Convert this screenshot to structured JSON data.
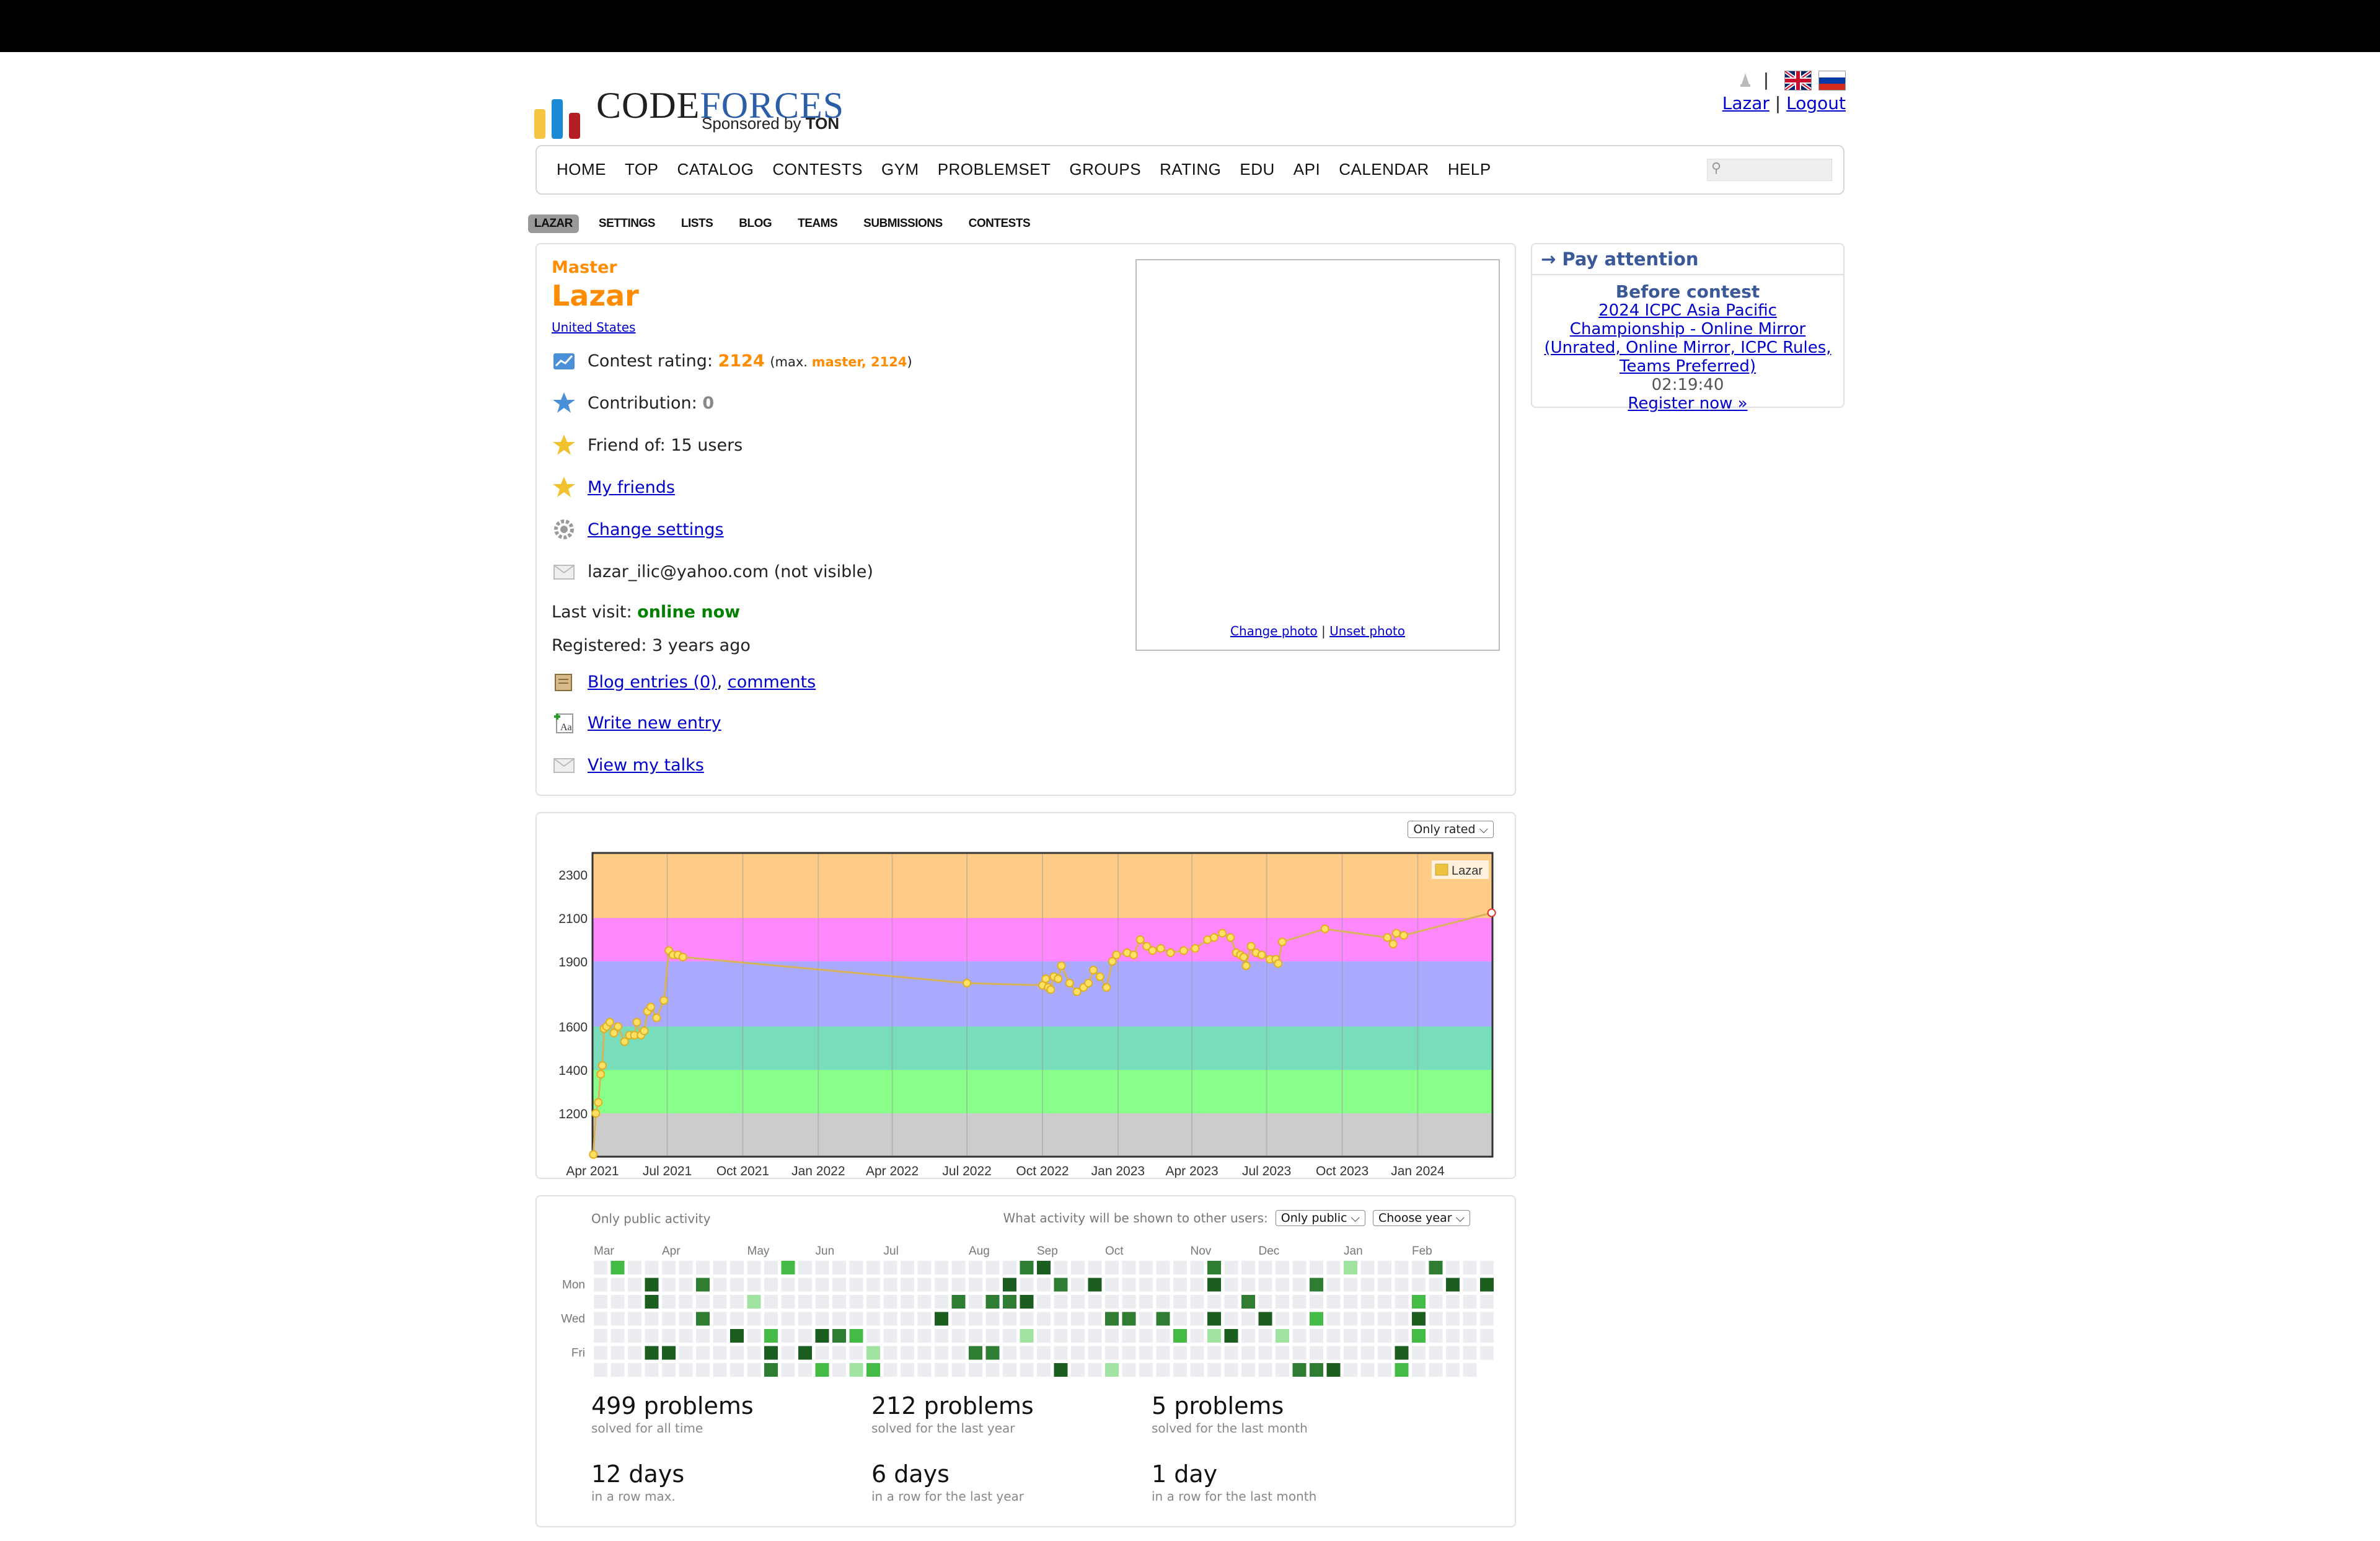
{
  "header": {
    "logo_brand_first": "CODE",
    "logo_brand_second": "FORCES",
    "logo_sponsor_prefix": "Sponsored by",
    "logo_sponsor_name": "TON",
    "lang_separator": "|",
    "user_link": "Lazar",
    "user_separator": "|",
    "logout_link": "Logout"
  },
  "menu": {
    "items": [
      "HOME",
      "TOP",
      "CATALOG",
      "CONTESTS",
      "GYM",
      "PROBLEMSET",
      "GROUPS",
      "RATING",
      "EDU",
      "API",
      "CALENDAR",
      "HELP"
    ]
  },
  "subnav": {
    "items": [
      "LAZAR",
      "SETTINGS",
      "LISTS",
      "BLOG",
      "TEAMS",
      "SUBMISSIONS",
      "CONTESTS"
    ],
    "active": "LAZAR"
  },
  "profile": {
    "rank": "Master",
    "handle": "Lazar",
    "country": "United States",
    "rating_label": "Contest rating:",
    "rating_value": "2124",
    "rating_max_prefix": "(max.",
    "rating_max": "master, 2124",
    "rating_max_suffix": ")",
    "contribution_label": "Contribution:",
    "contribution_value": "0",
    "friend_of": "Friend of: 15 users",
    "my_friends": "My friends",
    "change_settings": "Change settings",
    "email": "lazar_ilic@yahoo.com (not visible)",
    "last_visit_label": "Last visit:",
    "last_visit_value": "online now",
    "registered": "Registered: 3 years ago",
    "blog_entries": "Blog entries (0)",
    "blog_sep": ",",
    "comments": "comments",
    "write_entry": "Write new entry",
    "view_talks": "View my talks",
    "change_photo": "Change photo",
    "photo_sep": "|",
    "unset_photo": "Unset photo"
  },
  "attention": {
    "header": "→ Pay attention",
    "title": "Before contest",
    "contest_link": "2024 ICPC Asia Pacific Championship - Online Mirror (Unrated, Online Mirror, ICPC Rules, Teams Preferred)",
    "timer": "02:19:40",
    "register": "Register now »"
  },
  "rating_graph": {
    "filter": "Only rated"
  },
  "chart_data": {
    "type": "line",
    "series": [
      {
        "name": "Lazar",
        "color": "#edc240",
        "points": [
          [
            "2021-04-02",
            1010
          ],
          [
            "2021-04-05",
            1200
          ],
          [
            "2021-04-08",
            1250
          ],
          [
            "2021-04-11",
            1380
          ],
          [
            "2021-04-13",
            1420
          ],
          [
            "2021-04-15",
            1590
          ],
          [
            "2021-04-18",
            1600
          ],
          [
            "2021-04-22",
            1620
          ],
          [
            "2021-04-27",
            1570
          ],
          [
            "2021-05-02",
            1600
          ],
          [
            "2021-05-10",
            1530
          ],
          [
            "2021-05-16",
            1560
          ],
          [
            "2021-05-22",
            1560
          ],
          [
            "2021-05-25",
            1620
          ],
          [
            "2021-05-30",
            1560
          ],
          [
            "2021-06-03",
            1580
          ],
          [
            "2021-06-07",
            1670
          ],
          [
            "2021-06-11",
            1690
          ],
          [
            "2021-06-18",
            1640
          ],
          [
            "2021-06-27",
            1720
          ],
          [
            "2021-07-03",
            1950
          ],
          [
            "2021-07-08",
            1930
          ],
          [
            "2021-07-14",
            1930
          ],
          [
            "2021-07-20",
            1920
          ],
          [
            "2022-07-01",
            1800
          ],
          [
            "2022-10-01",
            1790
          ],
          [
            "2022-10-05",
            1820
          ],
          [
            "2022-10-08",
            1780
          ],
          [
            "2022-10-11",
            1770
          ],
          [
            "2022-10-15",
            1830
          ],
          [
            "2022-10-20",
            1820
          ],
          [
            "2022-10-24",
            1880
          ],
          [
            "2022-11-03",
            1800
          ],
          [
            "2022-11-12",
            1760
          ],
          [
            "2022-11-20",
            1780
          ],
          [
            "2022-11-26",
            1800
          ],
          [
            "2022-12-02",
            1860
          ],
          [
            "2022-12-10",
            1830
          ],
          [
            "2022-12-18",
            1780
          ],
          [
            "2022-12-25",
            1900
          ],
          [
            "2022-12-30",
            1930
          ],
          [
            "2023-01-12",
            1940
          ],
          [
            "2023-01-20",
            1930
          ],
          [
            "2023-01-28",
            2000
          ],
          [
            "2023-02-05",
            1970
          ],
          [
            "2023-02-12",
            1950
          ],
          [
            "2023-02-22",
            1960
          ],
          [
            "2023-03-06",
            1940
          ],
          [
            "2023-03-22",
            1950
          ],
          [
            "2023-04-05",
            1960
          ],
          [
            "2023-04-20",
            2000
          ],
          [
            "2023-04-28",
            2010
          ],
          [
            "2023-05-08",
            2030
          ],
          [
            "2023-05-18",
            2010
          ],
          [
            "2023-05-25",
            1940
          ],
          [
            "2023-05-30",
            1930
          ],
          [
            "2023-06-03",
            1920
          ],
          [
            "2023-06-06",
            1880
          ],
          [
            "2023-06-12",
            1970
          ],
          [
            "2023-06-18",
            1940
          ],
          [
            "2023-06-25",
            1930
          ],
          [
            "2023-07-05",
            1910
          ],
          [
            "2023-07-12",
            1910
          ],
          [
            "2023-07-15",
            1890
          ],
          [
            "2023-07-20",
            1990
          ],
          [
            "2023-09-10",
            2050
          ],
          [
            "2023-11-25",
            2010
          ],
          [
            "2023-12-02",
            1980
          ],
          [
            "2023-12-06",
            2030
          ],
          [
            "2023-12-15",
            2020
          ],
          [
            "2024-03-31",
            2124
          ]
        ]
      }
    ],
    "x_ticks": [
      "Apr 2021",
      "Jul 2021",
      "Oct 2021",
      "Jan 2022",
      "Apr 2022",
      "Jul 2022",
      "Oct 2022",
      "Jan 2023",
      "Apr 2023",
      "Jul 2023",
      "Oct 2023",
      "Jan 2024"
    ],
    "y_ticks": [
      1200,
      1400,
      1600,
      1900,
      2100,
      2300
    ],
    "ylim": [
      1000,
      2400
    ],
    "xlim": [
      "2021-04-01",
      "2024-04-01"
    ],
    "bands": [
      {
        "from": 1000,
        "to": 1200,
        "color": "#cccccc"
      },
      {
        "from": 1200,
        "to": 1400,
        "color": "#88ff88"
      },
      {
        "from": 1400,
        "to": 1600,
        "color": "#77ddbb"
      },
      {
        "from": 1600,
        "to": 1900,
        "color": "#aaaaff"
      },
      {
        "from": 1900,
        "to": 2100,
        "color": "#ff88ff"
      },
      {
        "from": 2100,
        "to": 2400,
        "color": "#ffcc88"
      }
    ],
    "legend": "top-right",
    "grid": true
  },
  "activity": {
    "public_note": "Only public activity",
    "shown_label": "What activity will be shown to other users:",
    "shown_select": "Only public",
    "year_select": "Choose year",
    "months": [
      "Mar",
      "Apr",
      "May",
      "Jun",
      "Jul",
      "Aug",
      "Sep",
      "Oct",
      "Nov",
      "Dec",
      "Jan",
      "Feb"
    ],
    "day_labels": [
      "Mon",
      "Wed",
      "Fri"
    ],
    "colors": [
      "#ebedf0",
      "#a1e3a1",
      "#44bb44",
      "#2e7d32",
      "#1b5e20"
    ],
    "stats": [
      {
        "value": "499 problems",
        "label": "solved for all time"
      },
      {
        "value": "212 problems",
        "label": "solved for the last year"
      },
      {
        "value": "5 problems",
        "label": "solved for the last month"
      },
      {
        "value": "12 days",
        "label": "in a row max."
      },
      {
        "value": "6 days",
        "label": "in a row for the last year"
      },
      {
        "value": "1 day",
        "label": "in a row for the last month"
      }
    ]
  }
}
